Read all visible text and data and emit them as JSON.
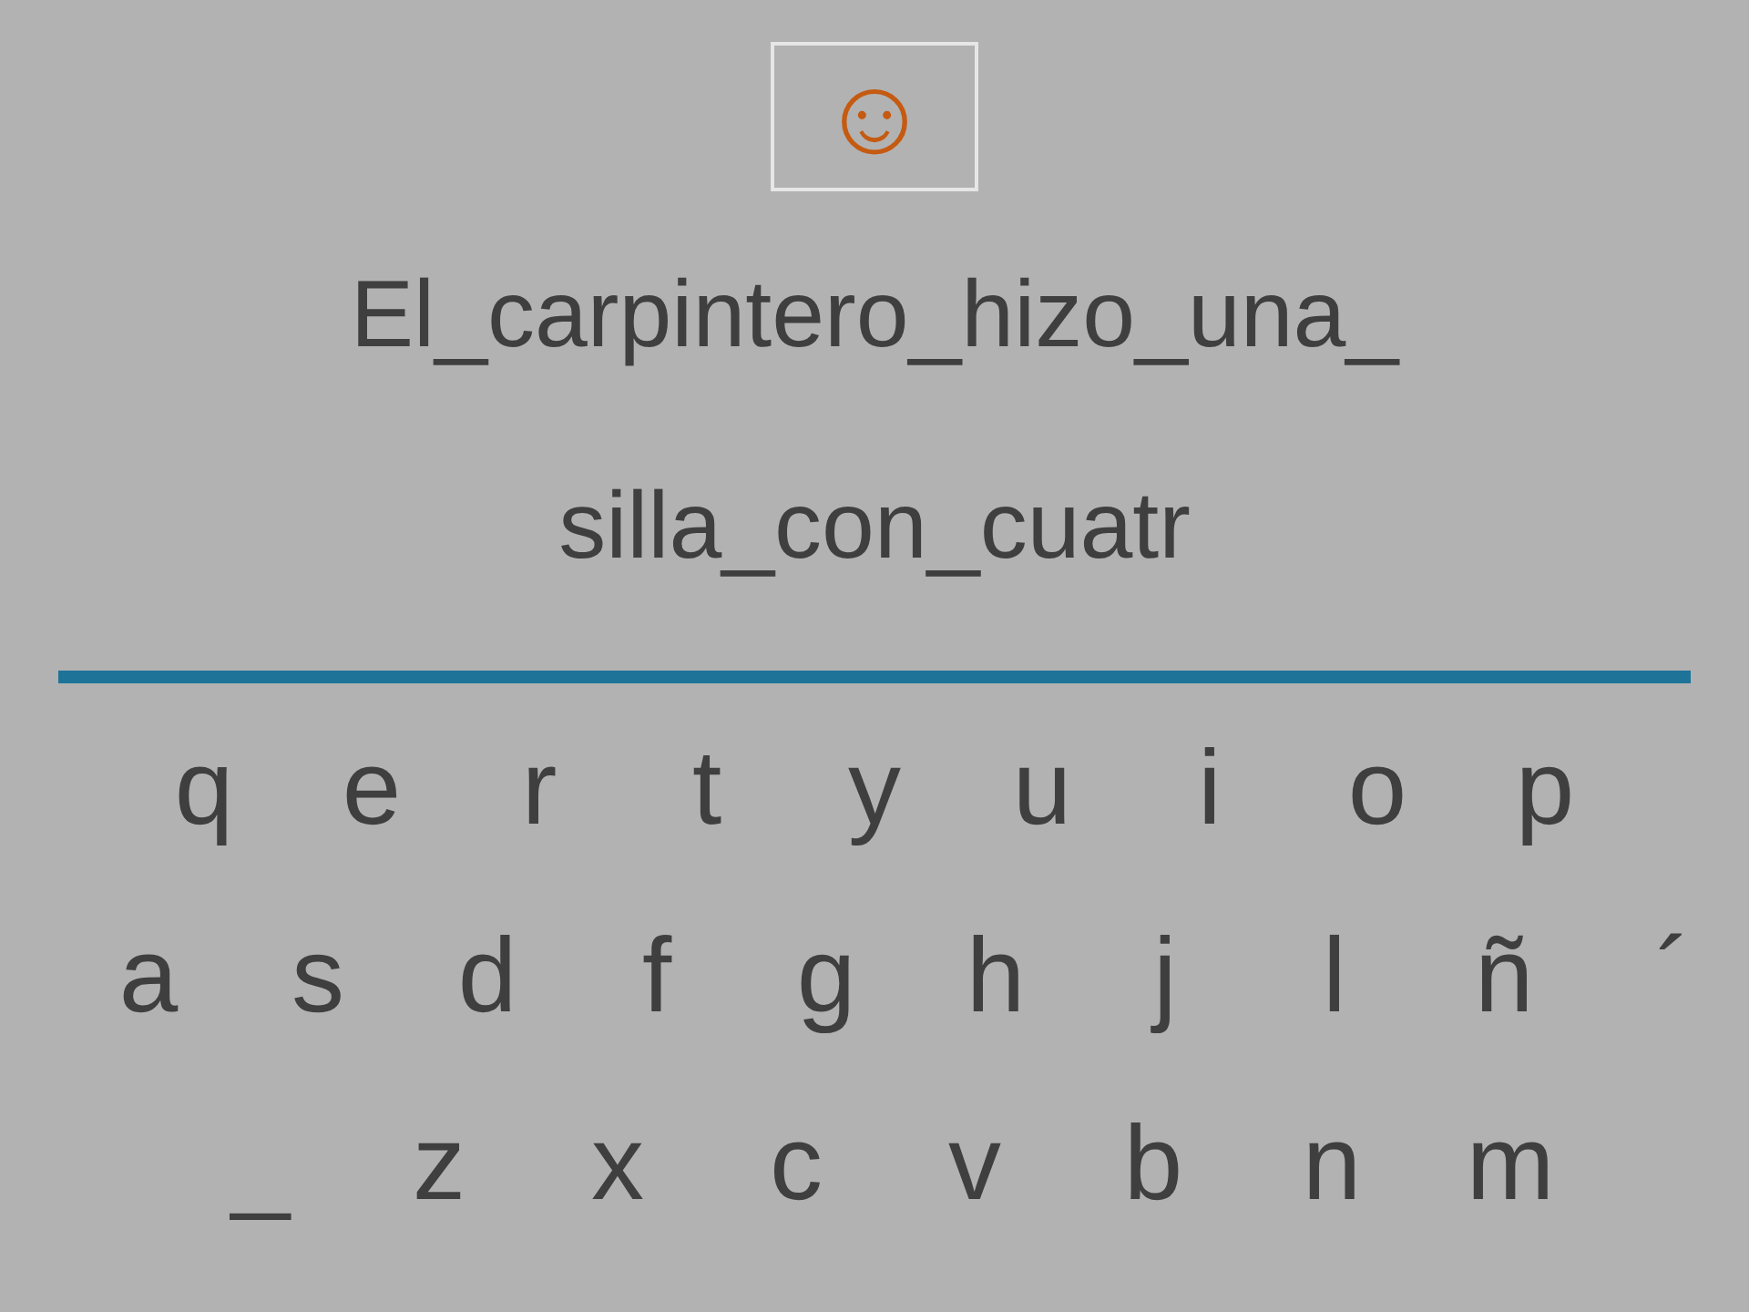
{
  "status_icon": "☺",
  "sentence_lines": [
    "El_carpintero_hizo_una_",
    "silla_con_cuatr"
  ],
  "keyboard_rows": [
    [
      "q",
      "e",
      "r",
      "t",
      "y",
      "u",
      "i",
      "o",
      "p"
    ],
    [
      "a",
      "s",
      "d",
      "f",
      "g",
      "h",
      "j",
      "l",
      "ñ",
      "´"
    ],
    [
      "_",
      "z",
      "x",
      "c",
      "v",
      "b",
      "n",
      "m"
    ]
  ]
}
